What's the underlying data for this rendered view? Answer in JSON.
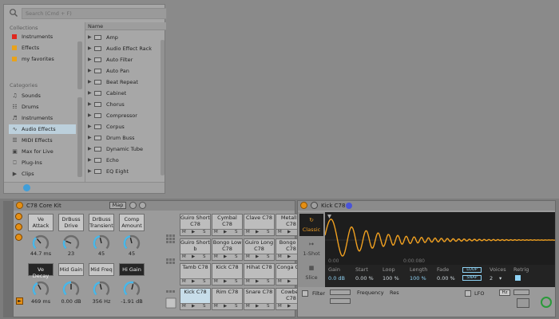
{
  "browser": {
    "search_placeholder": "Search (Cmd + F)",
    "collections_title": "Collections",
    "collections": [
      {
        "label": "Instruments",
        "color": "#e0271e"
      },
      {
        "label": "Effects",
        "color": "#e8a21b"
      },
      {
        "label": "my favorites",
        "color": "#e8a21b"
      }
    ],
    "categories_title": "Categories",
    "categories": [
      {
        "label": "Sounds",
        "icon": "music-note-icon"
      },
      {
        "label": "Drums",
        "icon": "drum-grid-icon"
      },
      {
        "label": "Instruments",
        "icon": "instrument-icon"
      },
      {
        "label": "Audio Effects",
        "icon": "waveform-icon",
        "selected": true
      },
      {
        "label": "MIDI Effects",
        "icon": "midi-icon"
      },
      {
        "label": "Max for Live",
        "icon": "max-icon"
      },
      {
        "label": "Plug-Ins",
        "icon": "plug-icon"
      },
      {
        "label": "Clips",
        "icon": "clip-icon"
      }
    ],
    "name_header": "Name",
    "items": [
      "Amp",
      "Audio Effect Rack",
      "Auto Filter",
      "Auto Pan",
      "Beat Repeat",
      "Cabinet",
      "Chorus",
      "Compressor",
      "Corpus",
      "Drum Buss",
      "Dynamic Tube",
      "Echo",
      "EQ Eight"
    ]
  },
  "rack": {
    "title": "C78 Core Kit",
    "map_label": "Map",
    "macros_top": [
      {
        "label": "Ve Attack",
        "value": "44.7 ms"
      },
      {
        "label": "DrBuss Drive",
        "value": "23"
      },
      {
        "label": "DrBuss Transient",
        "value": "45"
      },
      {
        "label": "Comp Amount",
        "value": "45"
      }
    ],
    "macros_bottom": [
      {
        "label": "Ve Decay",
        "value": "469 ms",
        "dark": true
      },
      {
        "label": "Mid Gain",
        "value": "0.00 dB",
        "dark": false
      },
      {
        "label": "Mid Freq",
        "value": "356 Hz",
        "dark": false
      },
      {
        "label": "Hi Gain",
        "value": "-1.91 dB",
        "dark": true
      }
    ],
    "pad_controls": [
      "M",
      "▶",
      "S"
    ],
    "pads": [
      [
        "Guiro Short C78",
        "Cymbal C78",
        "Clave C78",
        "Metallic C78"
      ],
      [
        "Guiro Short b",
        "Bongo Low C78",
        "Guiro Long C78",
        "Bongo Hi C78"
      ],
      [
        "Tamb C78",
        "Kick C78",
        "Hihat C78",
        "Conga C78"
      ],
      [
        "Kick C78",
        "Rim C78",
        "Snare C78",
        "Cowbell C78"
      ]
    ]
  },
  "sampler": {
    "title": "Kick C78",
    "modes": [
      "Classic",
      "1-Shot",
      "Slice"
    ],
    "timeline": [
      "0:00",
      "0:00:080"
    ],
    "params": [
      {
        "label": "Gain",
        "value": "0.0 dB"
      },
      {
        "label": "Start",
        "value": "0.00 %"
      },
      {
        "label": "Loop",
        "value": "100 %"
      },
      {
        "label": "Length",
        "value": "100 %"
      },
      {
        "label": "Fade",
        "value": "0.00 %"
      }
    ],
    "loop_label": "LOOP",
    "snap_label": "SNAP",
    "voices_label": "Voices",
    "voices_value": "2",
    "retrig_label": "Retrig",
    "filter_label": "Filter",
    "frequency_label": "Frequency",
    "res_label": "Res",
    "lfo_label": "LFO",
    "hz_label": "Hz",
    "accent": "#f0a020"
  }
}
